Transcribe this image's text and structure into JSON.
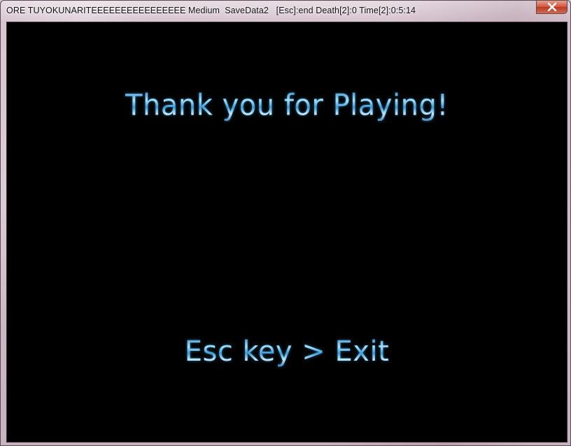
{
  "window": {
    "title": "ORE TUYOKUNARITEEEEEEEEEEEEEEEE Medium  SaveData2   [Esc]:end Death[2]:0 Time[2]:0:5:14",
    "buttons": {
      "close_icon": "close-icon"
    },
    "colors": {
      "frame": "#d6c4cf",
      "close_button": "#c94a33",
      "client_background": "#000000"
    }
  },
  "game": {
    "headline": "Thank you for Playing!",
    "exit_hint": "Esc key > Exit",
    "text_color": "#6cc6f2"
  }
}
